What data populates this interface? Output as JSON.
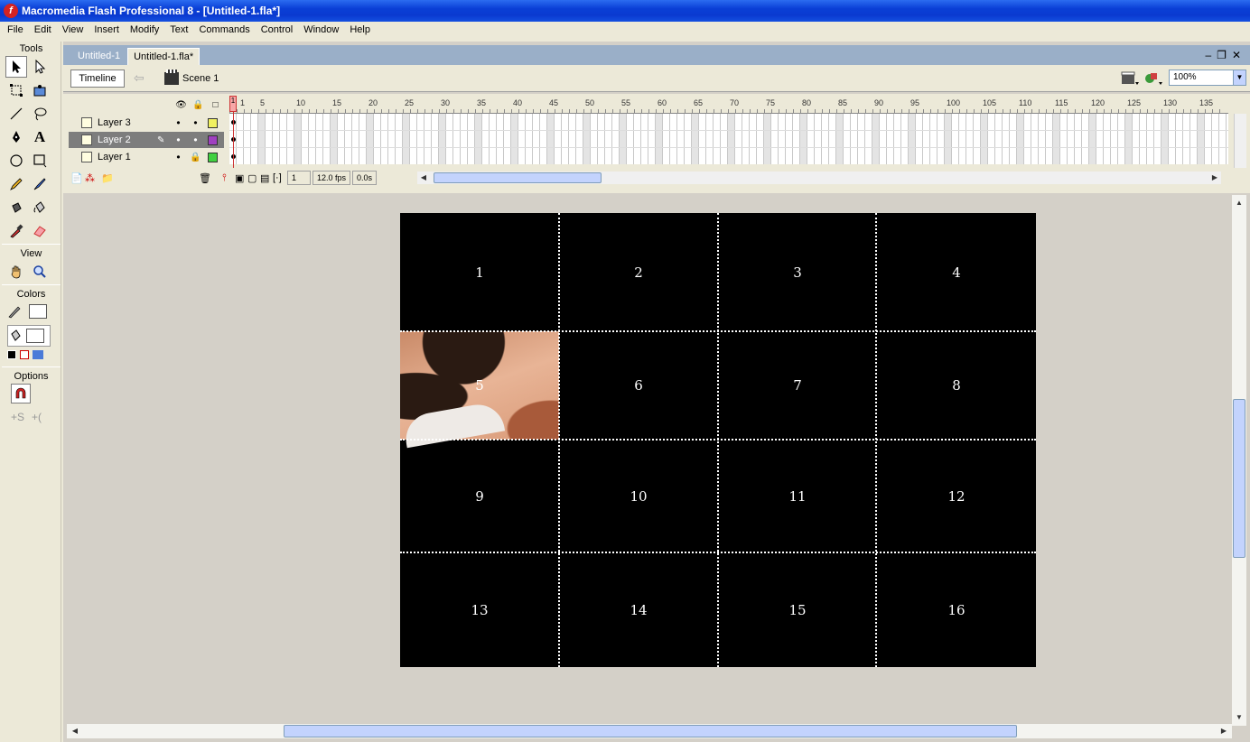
{
  "window": {
    "title": "Macromedia Flash Professional 8 - [Untitled-1.fla*]"
  },
  "menu": [
    "File",
    "Edit",
    "View",
    "Insert",
    "Modify",
    "Text",
    "Commands",
    "Control",
    "Window",
    "Help"
  ],
  "tools_panel": {
    "tools_label": "Tools",
    "view_label": "View",
    "colors_label": "Colors",
    "options_label": "Options",
    "tools": [
      "selection-icon",
      "subselection-icon",
      "free-transform-icon",
      "fill-transform-icon",
      "line-icon",
      "lasso-icon",
      "pen-icon",
      "text-icon",
      "oval-icon",
      "rectangle-icon",
      "pencil-icon",
      "brush-icon",
      "ink-bottle-icon",
      "paint-bucket-icon",
      "eyedropper-icon",
      "eraser-icon"
    ]
  },
  "doc_tabs": [
    "Untitled-1",
    "Untitled-1.fla*"
  ],
  "edit_bar": {
    "timeline_button": "Timeline",
    "scene": "Scene 1",
    "zoom": "100%"
  },
  "timeline": {
    "ruler": [
      "1",
      "5",
      "10",
      "15",
      "20",
      "25",
      "30",
      "35",
      "40",
      "45",
      "50",
      "55",
      "60",
      "65",
      "70",
      "75",
      "80",
      "85",
      "90",
      "95",
      "100",
      "105",
      "110",
      "115",
      "120",
      "125",
      "130",
      "135"
    ],
    "layers": [
      {
        "name": "Layer 3",
        "color": "#f0f060",
        "selected": false,
        "locked": false
      },
      {
        "name": "Layer 2",
        "color": "#a040c0",
        "selected": true,
        "locked": false
      },
      {
        "name": "Layer 1",
        "color": "#40d040",
        "selected": false,
        "locked": true
      }
    ],
    "current_frame": "1",
    "fps": "12.0 fps",
    "elapsed": "0.0s"
  },
  "stage": {
    "cells": [
      "1",
      "2",
      "3",
      "4",
      "5",
      "6",
      "7",
      "8",
      "9",
      "10",
      "11",
      "12",
      "13",
      "14",
      "15",
      "16"
    ],
    "revealed_cell": "5"
  }
}
